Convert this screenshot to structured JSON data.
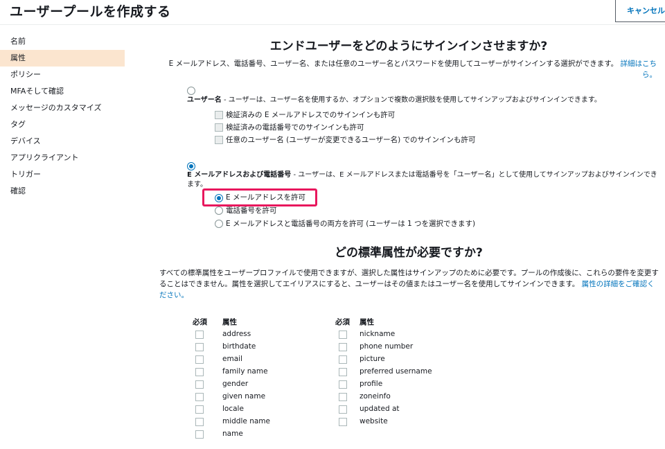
{
  "header": {
    "title": "ユーザープールを作成する",
    "cancel_label": "キャンセル"
  },
  "sidebar": {
    "items": [
      {
        "label": "名前",
        "active": false
      },
      {
        "label": "属性",
        "active": true
      },
      {
        "label": "ポリシー",
        "active": false
      },
      {
        "label": "MFAそして確認",
        "active": false
      },
      {
        "label": "メッセージのカスタマイズ",
        "active": false
      },
      {
        "label": "タグ",
        "active": false
      },
      {
        "label": "デバイス",
        "active": false
      },
      {
        "label": "アプリクライアント",
        "active": false
      },
      {
        "label": "トリガー",
        "active": false
      },
      {
        "label": "確認",
        "active": false
      }
    ]
  },
  "signin": {
    "heading": "エンドユーザーをどのようにサインインさせますか?",
    "intro": "E メールアドレス、電話番号、ユーザー名、または任意のユーザー名とパスワードを使用してユーザーがサインインする選択ができます。詳細はこちら。",
    "intro_link": "詳細はこちら。",
    "username_option": {
      "title": "ユーザー名",
      "desc": " - ユーザーは、ユーザー名を使用するか、オプションで複数の選択肢を使用してサインアップおよびサインインできます。",
      "selected": false,
      "sub": [
        "検証済みの E メールアドレスでのサインインも許可",
        "検証済みの電話番号でのサインインも許可",
        "任意のユーザー名 (ユーザーが変更できるユーザー名) でのサインインも許可"
      ]
    },
    "email_phone_option": {
      "title": "E メールアドレスおよび電話番号",
      "desc": " - ユーザーは、E メールアドレスまたは電話番号を「ユーザー名」として使用してサインアップおよびサインインできます。",
      "selected": true,
      "sub": [
        {
          "label": "E メールアドレスを許可",
          "selected": true
        },
        {
          "label": "電話番号を許可",
          "selected": false
        },
        {
          "label": "E メールアドレスと電話番号の両方を許可 (ユーザーは 1 つを選択できます)",
          "selected": false
        }
      ]
    }
  },
  "attributes": {
    "heading": "どの標準属性が必要ですか?",
    "intro": "すべての標準属性をユーザープロファイルで使用できますが、選択した属性はサインアップのために必要です。プールの作成後に、これらの要件を変更することはできません。属性を選択してエイリアスにすると、ユーザーはその値またはユーザー名を使用してサインインできます。",
    "intro_link": "属性の詳細をご確認ください。",
    "required_header": "必須",
    "attribute_header": "属性",
    "left": [
      "address",
      "birthdate",
      "email",
      "family name",
      "gender",
      "given name",
      "locale",
      "middle name",
      "name"
    ],
    "right": [
      "nickname",
      "phone number",
      "picture",
      "preferred username",
      "profile",
      "zoneinfo",
      "updated at",
      "website"
    ]
  },
  "colors": {
    "accent": "#0073bb",
    "highlight": "#e8175d",
    "active_nav": "#fbe5cf"
  }
}
